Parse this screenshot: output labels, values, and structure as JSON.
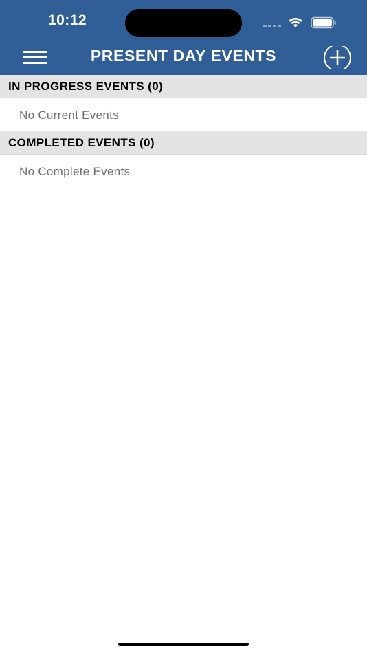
{
  "status_bar": {
    "time": "10:12"
  },
  "header": {
    "title": "PRESENT DAY EVENTS",
    "menu_icon": "hamburger-menu-icon",
    "add_icon": "add-circle-icon"
  },
  "sections": {
    "in_progress": {
      "title": "IN PROGRESS EVENTS (0)",
      "empty_message": "No Current Events"
    },
    "completed": {
      "title": "COMPLETED EVENTS (0)",
      "empty_message": "No Complete Events"
    }
  },
  "colors": {
    "header_bg": "#2f5f96",
    "section_bg": "#e3e3e3",
    "empty_text": "#6d6d6d"
  }
}
